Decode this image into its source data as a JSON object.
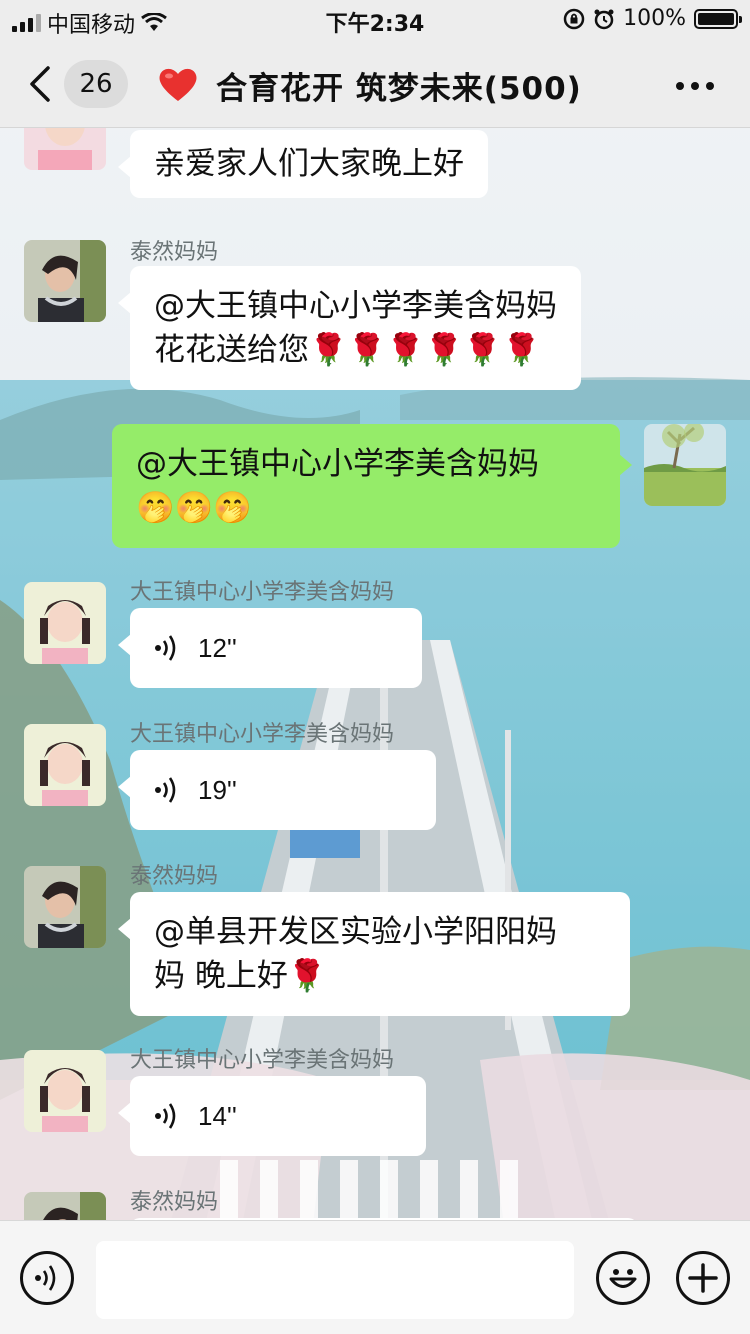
{
  "status_bar": {
    "carrier": "中国移动",
    "time": "下午2:34",
    "battery": "100%"
  },
  "nav": {
    "unread_count": "26",
    "title": "合育花开 筑梦未来(500)"
  },
  "messages": [
    {
      "type": "text",
      "side": "left",
      "sender": "",
      "text": "亲爱家人们大家晚上好"
    },
    {
      "type": "text",
      "side": "left",
      "sender": "泰然妈妈",
      "line1": "@大王镇中心小学李美含妈妈",
      "line2": "花花送给您",
      "emoji": "🌹🌹🌹🌹🌹🌹"
    },
    {
      "type": "text",
      "side": "right",
      "sender": "",
      "line1": "@大王镇中心小学李美含妈妈",
      "emoji": "🤭🤭🤭"
    },
    {
      "type": "voice",
      "side": "left",
      "sender": "大王镇中心小学李美含妈妈",
      "duration": "12''"
    },
    {
      "type": "voice",
      "side": "left",
      "sender": "大王镇中心小学李美含妈妈",
      "duration": "19''"
    },
    {
      "type": "text",
      "side": "left",
      "sender": "泰然妈妈",
      "line1": "@单县开发区实验小学阳阳妈",
      "line2": "妈 晚上好",
      "emoji": "🌹"
    },
    {
      "type": "voice",
      "side": "left",
      "sender": "大王镇中心小学李美含妈妈",
      "duration": "14''"
    },
    {
      "type": "text",
      "side": "left",
      "sender": "泰然妈妈",
      "text": ""
    }
  ],
  "input": {
    "placeholder": ""
  },
  "icons": {
    "back": "chevron-left-icon",
    "title_heart": "heart-icon",
    "more": "more-dots-icon",
    "voice_input": "voice-input-icon",
    "sticker": "smiley-icon",
    "plus": "plus-icon"
  },
  "colors": {
    "my_bubble": "#95ec69",
    "other_bubble": "#ffffff",
    "heart": "#e8312f"
  }
}
